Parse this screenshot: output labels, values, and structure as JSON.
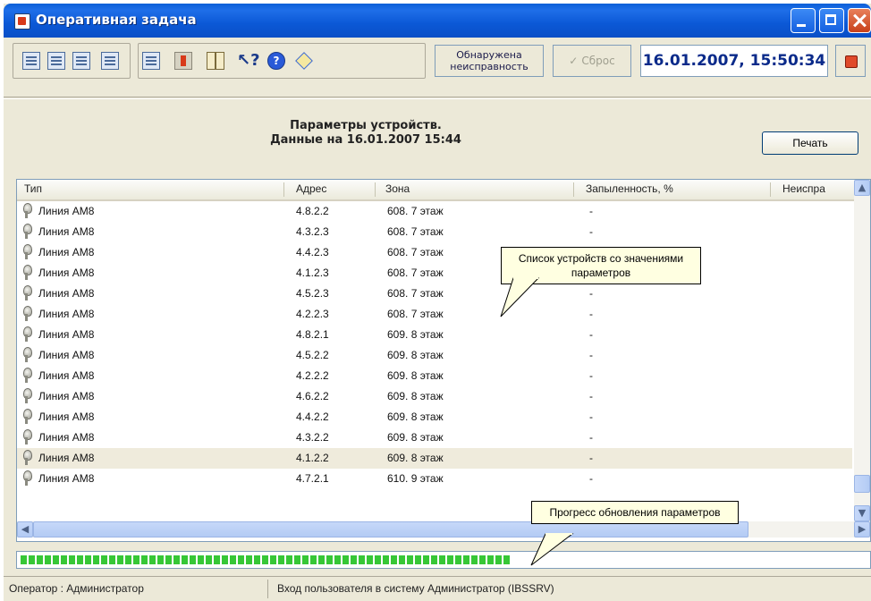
{
  "window": {
    "title": "Оперативная задача"
  },
  "toolbar": {
    "detect_label": "Обнаружена неисправность",
    "reset_label": "Сброс",
    "datetime": "16.01.2007, 15:50:34"
  },
  "header": {
    "line1": "Параметры устройств.",
    "line2": "Данные на 16.01.2007 15:44",
    "print_label": "Печать"
  },
  "table": {
    "columns": [
      "Тип",
      "Адрес",
      "Зона",
      "Запыленность, %",
      "Неиспра"
    ],
    "rows": [
      {
        "type": "Линия АМ8",
        "address": "4.8.2.2",
        "zone": "608. 7 этаж",
        "dust": "-"
      },
      {
        "type": "Линия АМ8",
        "address": "4.3.2.3",
        "zone": "608. 7 этаж",
        "dust": "-"
      },
      {
        "type": "Линия АМ8",
        "address": "4.4.2.3",
        "zone": "608. 7 этаж",
        "dust": "-"
      },
      {
        "type": "Линия АМ8",
        "address": "4.1.2.3",
        "zone": "608. 7 этаж",
        "dust": "-"
      },
      {
        "type": "Линия АМ8",
        "address": "4.5.2.3",
        "zone": "608. 7 этаж",
        "dust": "-"
      },
      {
        "type": "Линия АМ8",
        "address": "4.2.2.3",
        "zone": "608. 7 этаж",
        "dust": "-"
      },
      {
        "type": "Линия АМ8",
        "address": "4.8.2.1",
        "zone": "609. 8 этаж",
        "dust": "-"
      },
      {
        "type": "Линия АМ8",
        "address": "4.5.2.2",
        "zone": "609. 8 этаж",
        "dust": "-"
      },
      {
        "type": "Линия АМ8",
        "address": "4.2.2.2",
        "zone": "609. 8 этаж",
        "dust": "-"
      },
      {
        "type": "Линия АМ8",
        "address": "4.6.2.2",
        "zone": "609. 8 этаж",
        "dust": "-"
      },
      {
        "type": "Линия АМ8",
        "address": "4.4.2.2",
        "zone": "609. 8 этаж",
        "dust": "-"
      },
      {
        "type": "Линия АМ8",
        "address": "4.3.2.2",
        "zone": "609. 8 этаж",
        "dust": "-"
      },
      {
        "type": "Линия АМ8",
        "address": "4.1.2.2",
        "zone": "609. 8 этаж",
        "dust": "-"
      },
      {
        "type": "Линия АМ8",
        "address": "4.7.2.1",
        "zone": "610. 9 этаж",
        "dust": "-"
      }
    ],
    "selected_row": 12
  },
  "progress": {
    "fraction": 0.58
  },
  "statusbar": {
    "operator": "Оператор : Администратор",
    "message": "Вход пользователя в систему Администратор (IBSSRV)"
  },
  "callouts": {
    "list": "Список устройств со значениями параметров",
    "progress": "Прогресс обновления параметров"
  },
  "icons": [
    "app-icon",
    "minimize-icon",
    "maximize-icon",
    "close-icon",
    "toolbar-doc-icon",
    "toolbar-book-icon",
    "help-pointer-icon",
    "help-circle-icon",
    "diamond-icon",
    "alarm-icon",
    "stop-icon",
    "device-sensor-icon",
    "scroll-up-icon",
    "scroll-down-icon",
    "scroll-left-icon",
    "scroll-right-icon"
  ],
  "colors": {
    "title_bar": "#0a5fd8",
    "datetime_text": "#0a2a8a",
    "progress_green": "#37c736",
    "callout_bg": "#ffffe1",
    "selected_row": "#efebdc"
  }
}
